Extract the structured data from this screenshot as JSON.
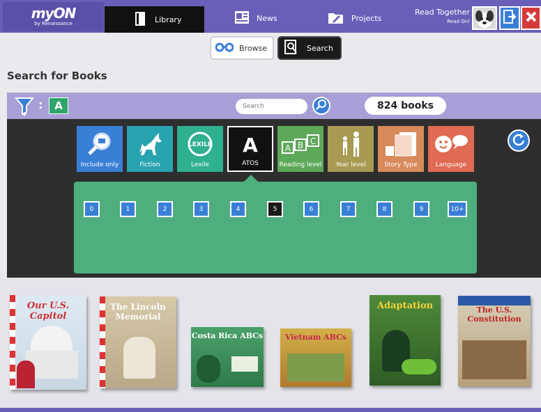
{
  "nav": {
    "logo_brand": "myON",
    "logo_by": "by Renaissance",
    "tabs": [
      {
        "label": "Library"
      },
      {
        "label": "News"
      },
      {
        "label": "Projects"
      }
    ],
    "read_together": "Read Together",
    "read_on": "Read On!"
  },
  "mode": {
    "browse_label": "Browse",
    "search_label": "Search"
  },
  "page_title": "Search for Books",
  "filterbar": {
    "active_filter": "A",
    "search_placeholder": "Search",
    "count": "824 books"
  },
  "filters": [
    {
      "label": "Include only",
      "icon": "magnifier-icon",
      "color": "#3a7fd6"
    },
    {
      "label": "Fiction",
      "icon": "unicorn-icon",
      "color": "#2aa3b0"
    },
    {
      "label": "Lexile",
      "icon": "lexile-icon",
      "color": "#2fb08f"
    },
    {
      "label": "ATOS",
      "icon": "letter-a-icon",
      "color": "#111111"
    },
    {
      "label": "Reading level",
      "icon": "abc-blocks-icon",
      "color": "#5ea85a"
    },
    {
      "label": "Year level",
      "icon": "people-icon",
      "color": "#a99a52"
    },
    {
      "label": "Story Type",
      "icon": "book-pages-icon",
      "color": "#d88a5b"
    },
    {
      "label": "Language",
      "icon": "speech-icon",
      "color": "#e06a52"
    }
  ],
  "levels": [
    "0",
    "1",
    "2",
    "3",
    "4",
    "5",
    "6",
    "7",
    "8",
    "9",
    "10+"
  ],
  "selected_level": "5",
  "books": [
    {
      "title": "Our U.S. Capitol"
    },
    {
      "title": "The Lincoln Memorial"
    },
    {
      "title": "Costa Rica ABCs"
    },
    {
      "title": "Vietnam ABCs"
    },
    {
      "title": "Adaptation"
    },
    {
      "title": "The U.S. Constitution"
    }
  ]
}
